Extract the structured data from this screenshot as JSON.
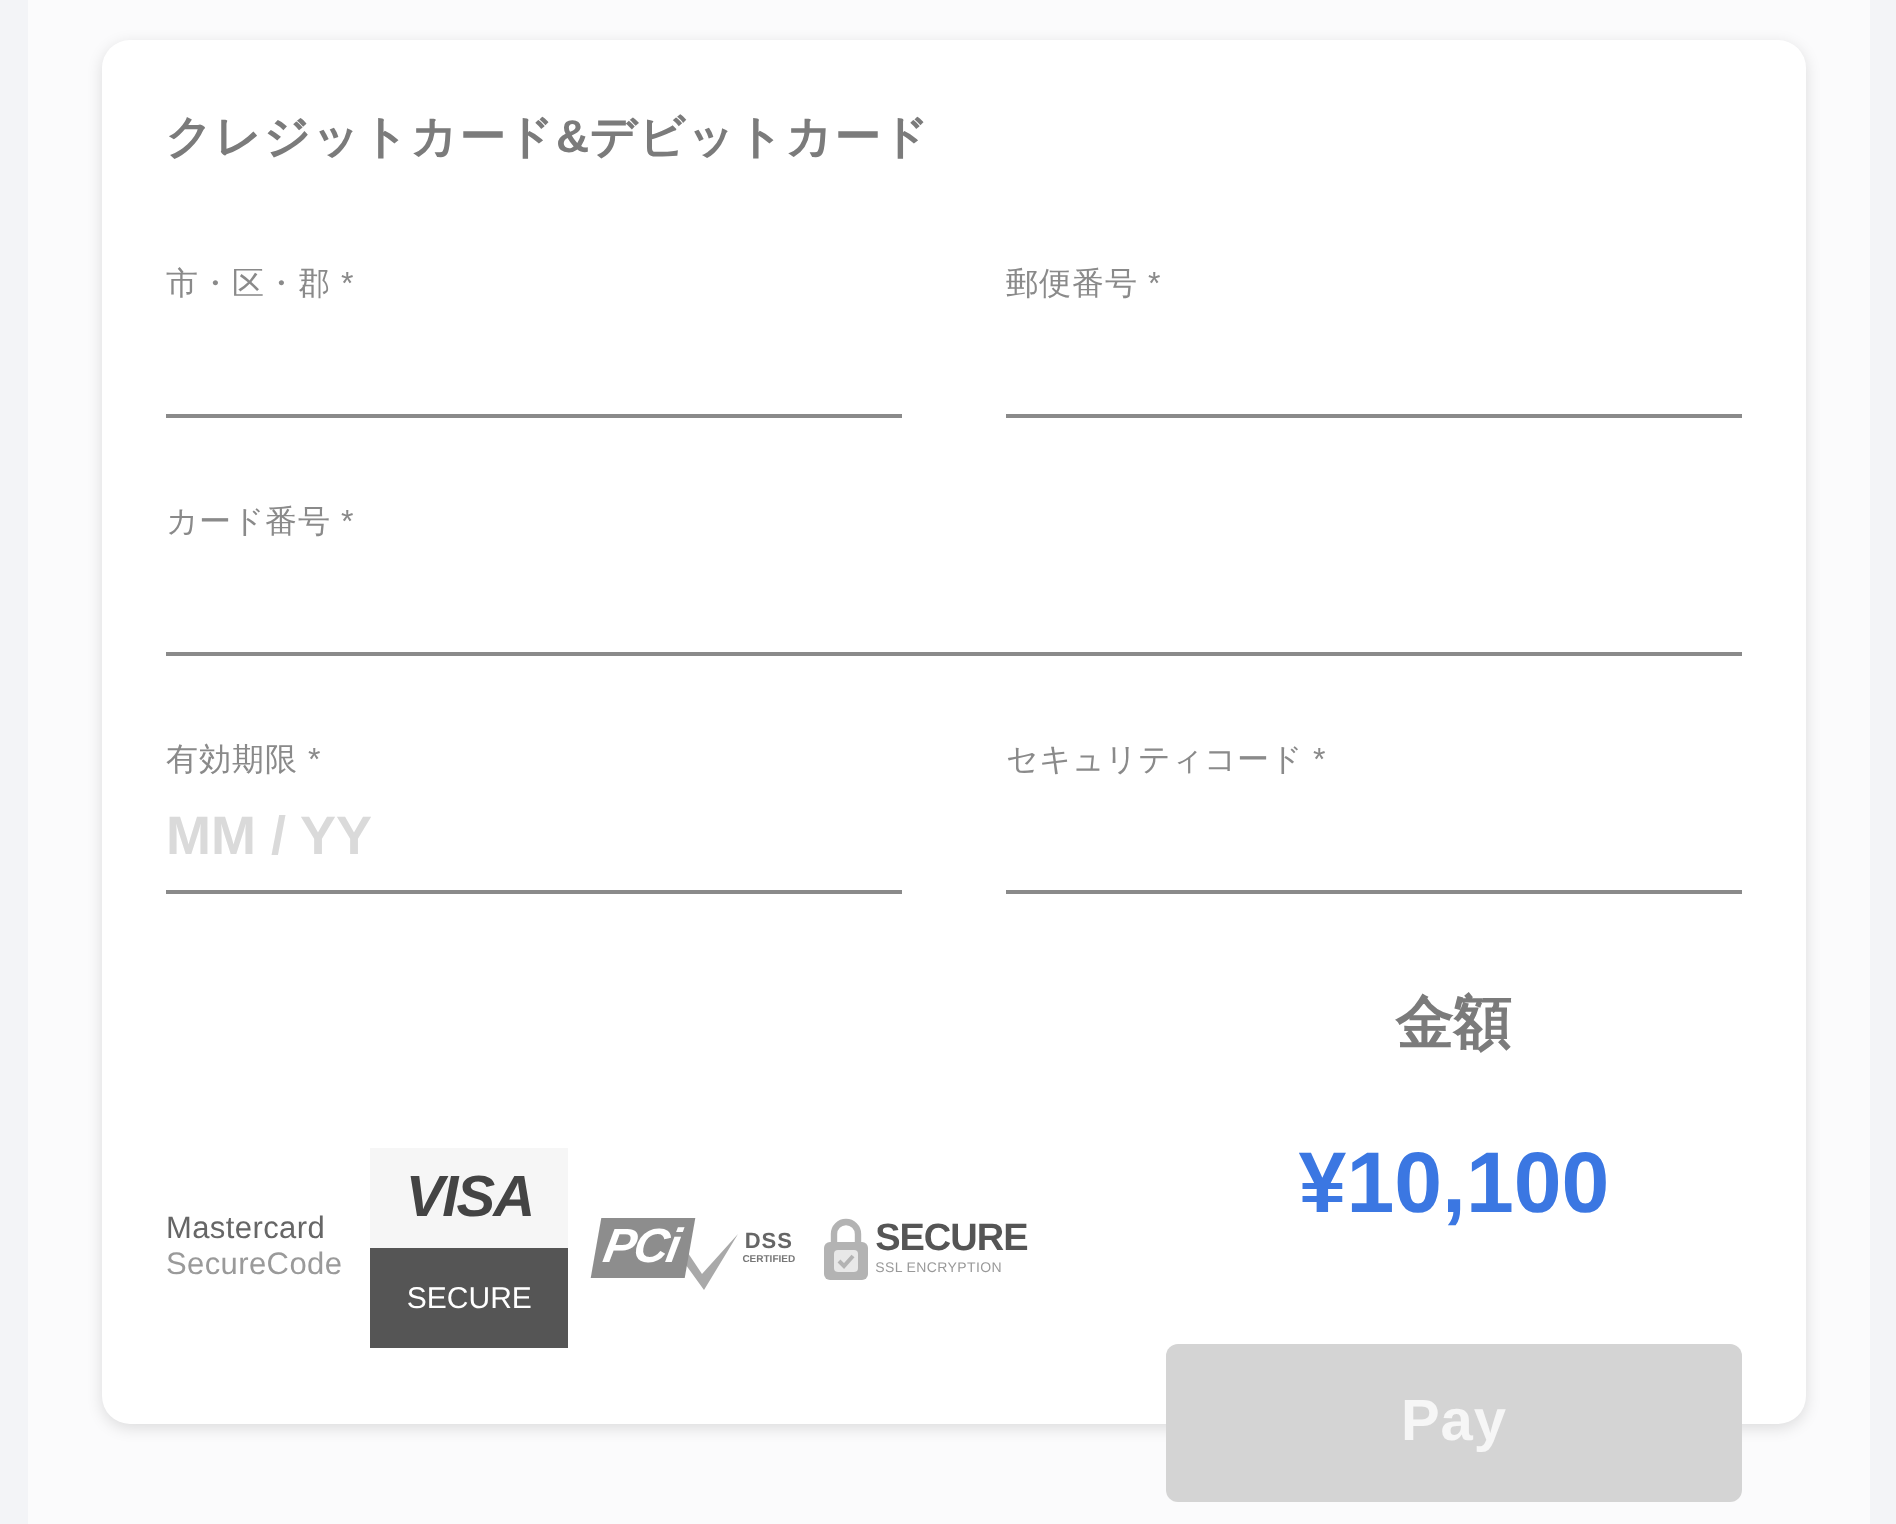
{
  "payment_form": {
    "title": "クレジットカード&デビットカード",
    "fields": [
      {
        "kind": "half",
        "label": "市・区・郡 *"
      },
      {
        "kind": "half",
        "label": "郵便番号 *"
      },
      {
        "kind": "full",
        "label": "カード番号 *"
      },
      {
        "kind": "half",
        "label": "有効期限 *",
        "placeholder": "MM / YY"
      },
      {
        "kind": "half",
        "label": "セキュリティコード *"
      }
    ],
    "badges": [
      {
        "kind": "mastercard",
        "lines": [
          "Mastercard",
          "SecureCode"
        ]
      },
      {
        "kind": "visa",
        "brand": "VISA",
        "caption": "SECURE"
      },
      {
        "kind": "pci",
        "brand": "PCi",
        "lines": [
          "DSS",
          "CERTIFIED"
        ]
      },
      {
        "kind": "ssl",
        "brand": "SECURE",
        "caption": "SSL ENCRYPTION"
      }
    ],
    "amount": {
      "label": "金額",
      "value": "¥10,100"
    },
    "pay_button": {
      "label": "Pay",
      "disabled": true
    }
  }
}
